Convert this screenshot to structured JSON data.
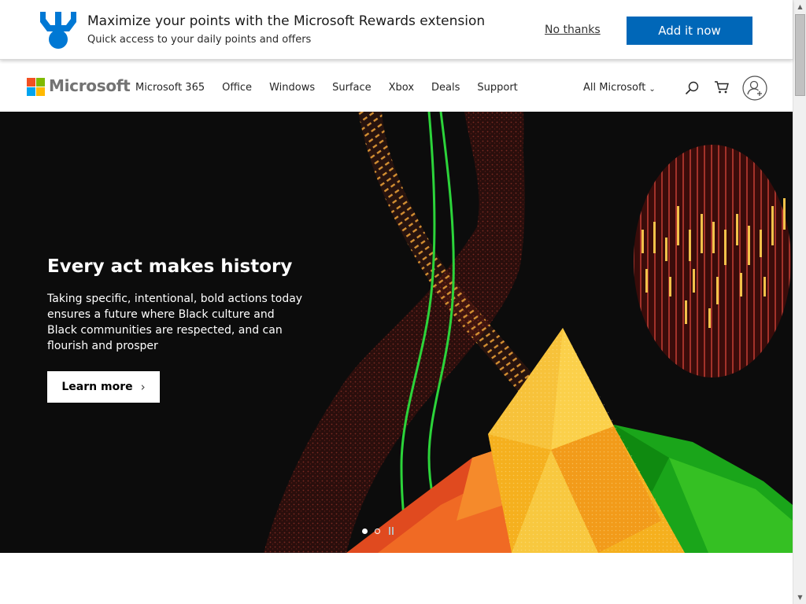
{
  "rewards_banner": {
    "title": "Maximize your points with the Microsoft Rewards extension",
    "subtitle": "Quick access to your daily points and offers",
    "dismiss_label": "No thanks",
    "cta_label": "Add it now",
    "icon": "medal-icon",
    "accent_color": "#0067b8"
  },
  "header": {
    "brand": "Microsoft",
    "nav_items": [
      "Microsoft 365",
      "Office",
      "Windows",
      "Surface",
      "Xbox",
      "Deals",
      "Support"
    ],
    "all_microsoft_label": "All Microsoft",
    "icons": [
      "search-icon",
      "cart-icon",
      "account-icon"
    ]
  },
  "hero": {
    "title": "Every act makes history",
    "body": "Taking specific, intentional, bold actions today ensures a future where Black culture and Black communities are respected, and can flourish and prosper",
    "cta_label": "Learn more",
    "cta_arrow": "›",
    "carousel": {
      "current_slide": 1,
      "total_slides": 2
    },
    "background_color": "#0c0c0c"
  },
  "scrollbar": {
    "up_glyph": "▲",
    "down_glyph": "▼"
  }
}
